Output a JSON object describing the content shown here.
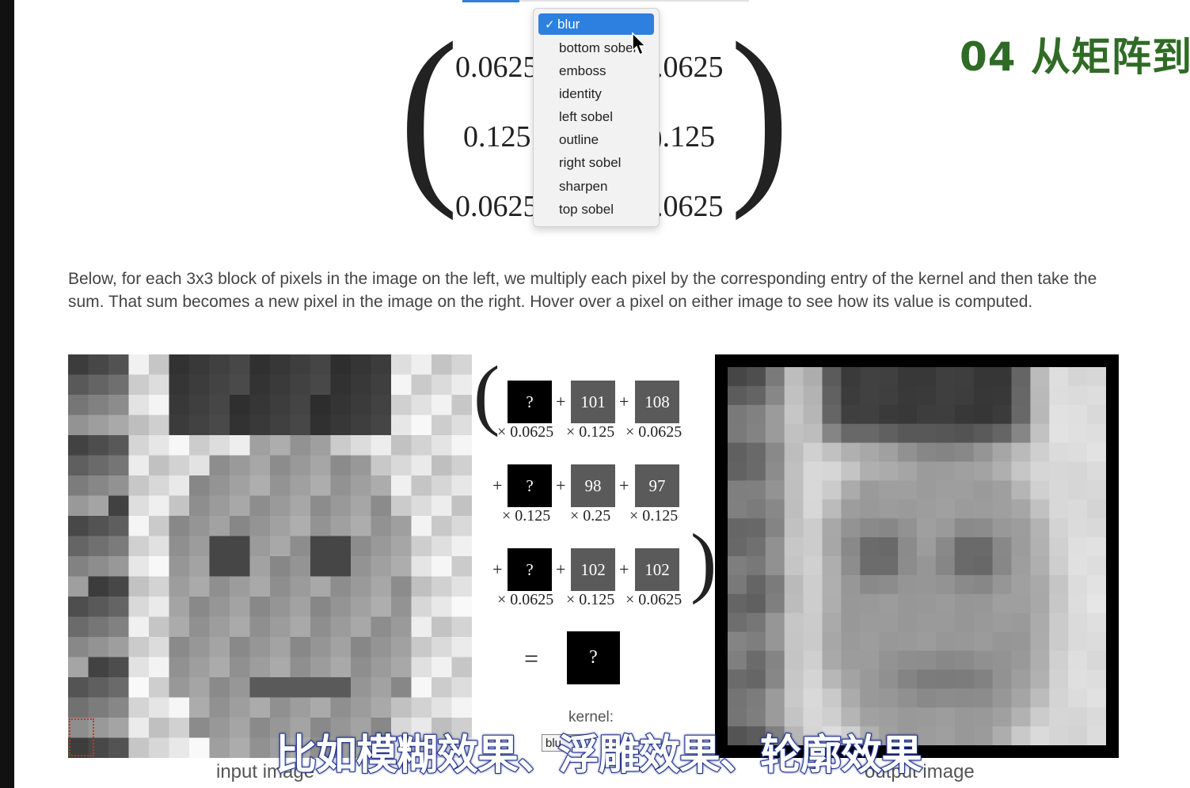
{
  "kernel_matrix": {
    "rows": [
      [
        "0.0625",
        ".0625"
      ],
      [
        "0.125",
        ").125"
      ],
      [
        "0.0625",
        ".0625"
      ]
    ]
  },
  "dropdown": {
    "selected_index": 0,
    "items": [
      "blur",
      "bottom sobel",
      "emboss",
      "identity",
      "left sobel",
      "outline",
      "right sobel",
      "sharpen",
      "top sobel"
    ]
  },
  "chapter_title": "04 从矩阵到",
  "description": "Below, for each 3x3 block of pixels in the image on the left, we multiply each pixel by the corresponding entry of the kernel and then take the sum. That sum becomes a new pixel in the image on the right. Hover over a pixel on either image to see how its value is computed.",
  "computation": {
    "rows": [
      {
        "cells": [
          "?",
          "101",
          "108"
        ],
        "weights": [
          "× 0.0625",
          "× 0.125",
          "× 0.0625"
        ]
      },
      {
        "cells": [
          "?",
          "98",
          "97"
        ],
        "weights": [
          "× 0.125",
          "× 0.25",
          "× 0.125"
        ]
      },
      {
        "cells": [
          "?",
          "102",
          "102"
        ],
        "weights": [
          "× 0.0625",
          "× 0.125",
          "× 0.0625"
        ]
      }
    ],
    "plus": "+",
    "equals": "=",
    "result": "?"
  },
  "kernel_label": "kernel:",
  "kernel_select_value": "blu",
  "input_caption": "input image",
  "output_caption": "output image",
  "subtitle": "比如模糊效果、浮雕效果、轮廓效果",
  "colors": {
    "accent": "#2d7fe0",
    "title_green": "#2f6b25",
    "subtitle_outline": "#1d2f8a"
  }
}
